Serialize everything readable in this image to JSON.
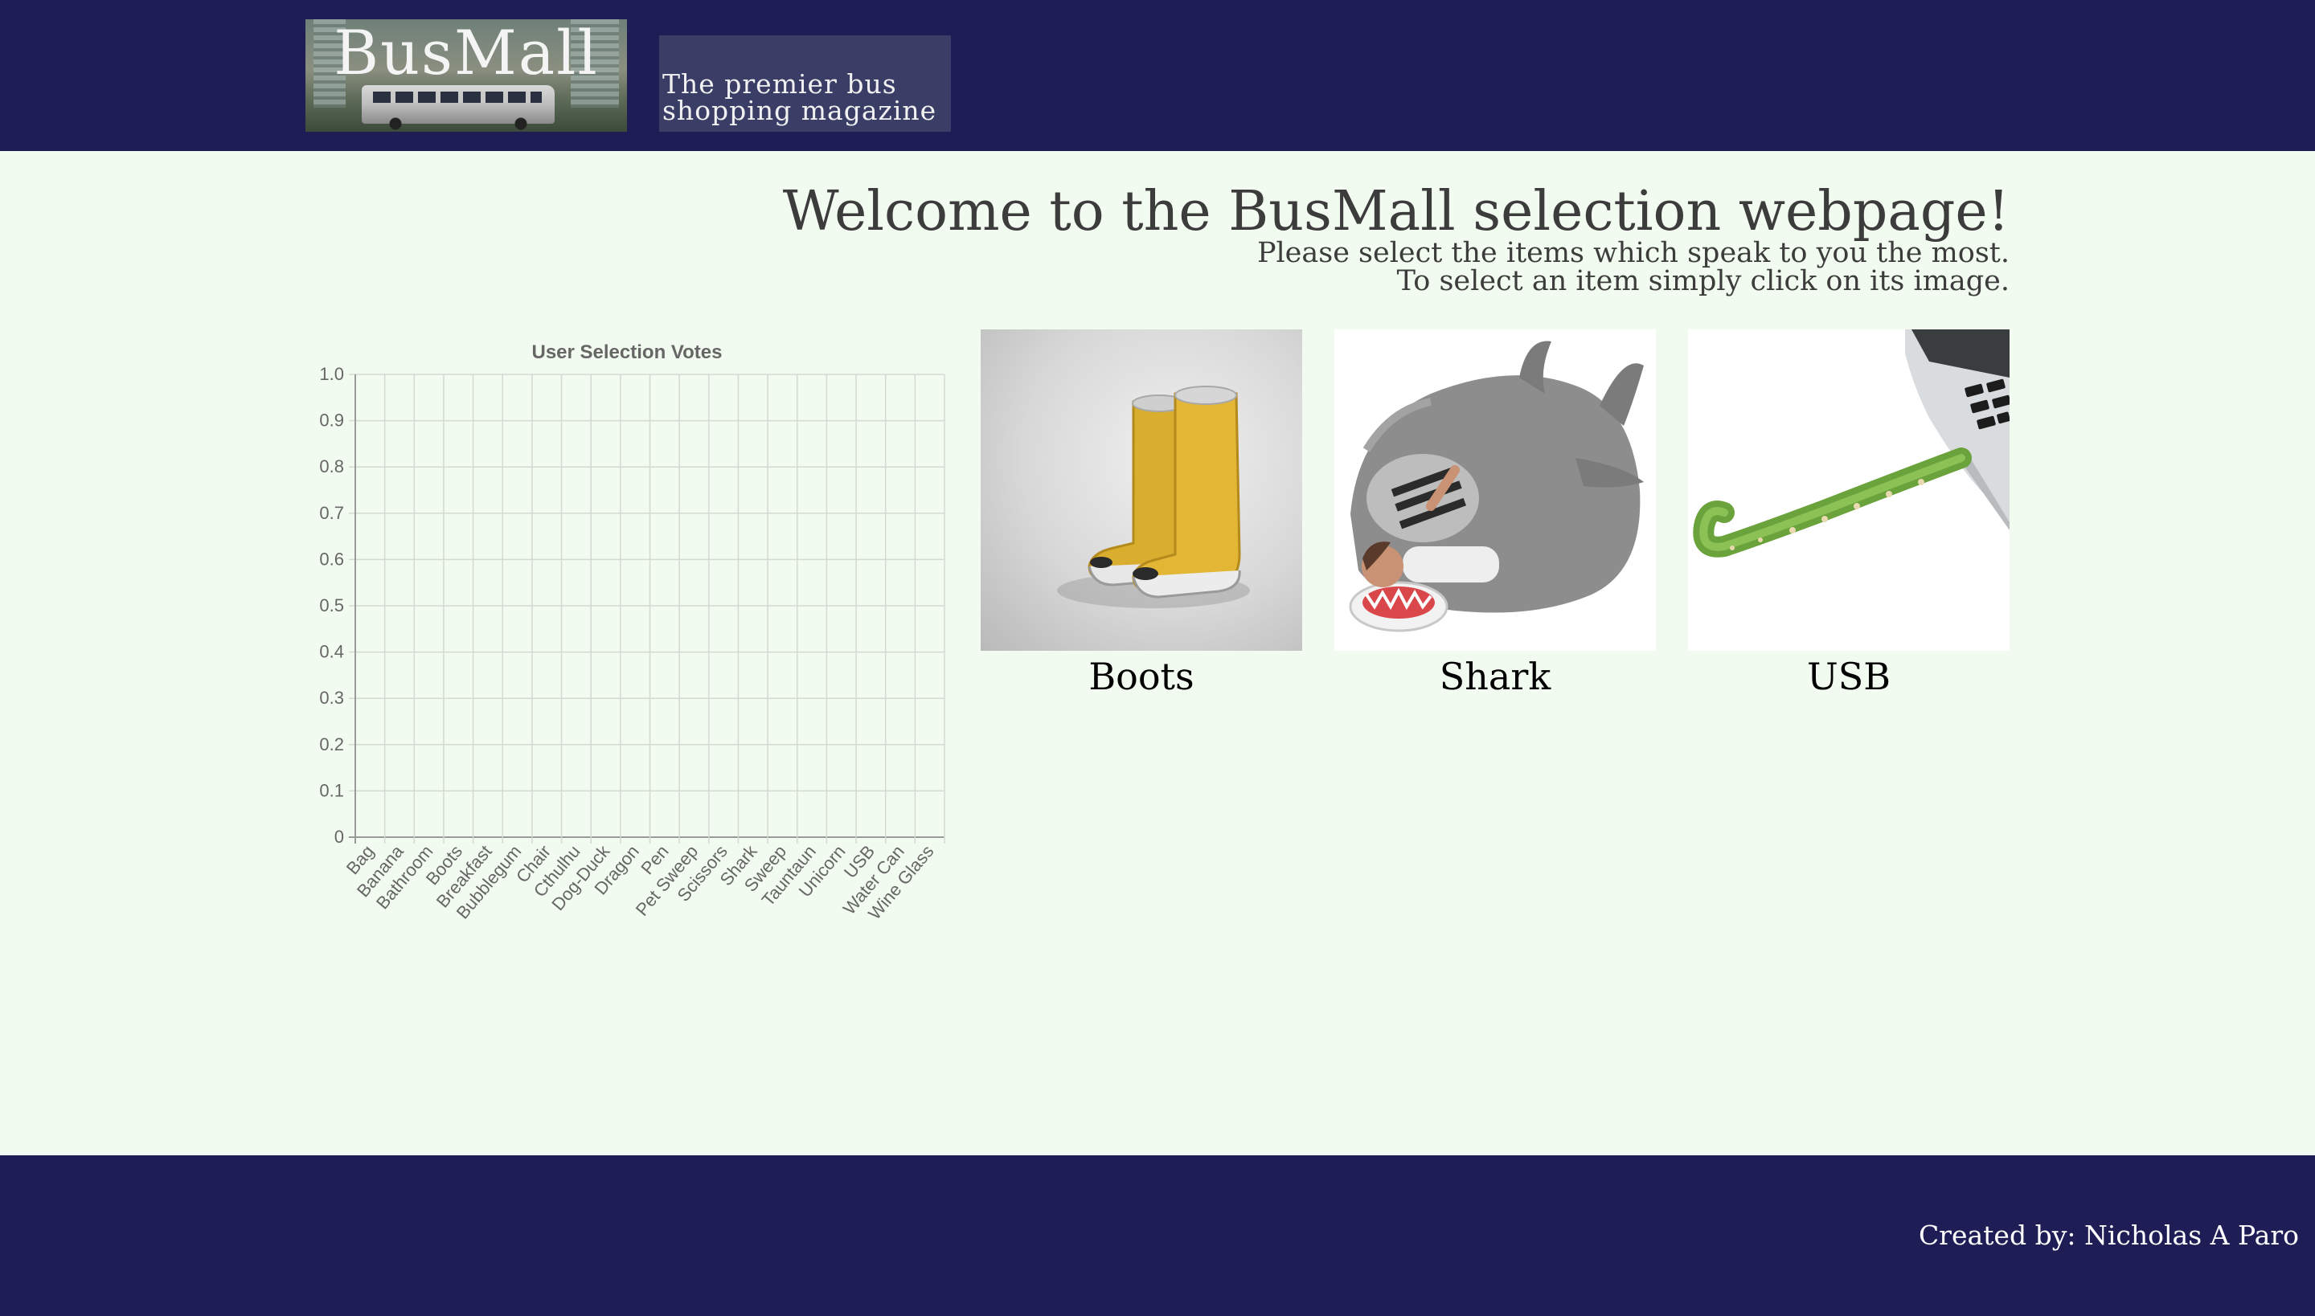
{
  "header": {
    "logo_text": "BusMall",
    "tagline": "The premier bus\nshopping magazine"
  },
  "main": {
    "welcome": "Welcome to the BusMall selection webpage!",
    "instructions_line1": "Please select the items which speak to you the most.",
    "instructions_line2": "To select an item simply click on its image."
  },
  "products": [
    {
      "name": "Boots",
      "icon": "boots-image"
    },
    {
      "name": "Shark",
      "icon": "shark-sleeping-bag-image"
    },
    {
      "name": "USB",
      "icon": "tentacle-usb-image"
    }
  ],
  "chart_data": {
    "type": "bar",
    "title": "User Selection Votes",
    "xlabel": "",
    "ylabel": "",
    "categories": [
      "Bag",
      "Banana",
      "Bathroom",
      "Boots",
      "Breakfast",
      "Bubblegum",
      "Chair",
      "Cthulhu",
      "Dog-Duck",
      "Dragon",
      "Pen",
      "Pet Sweep",
      "Scissors",
      "Shark",
      "Sweep",
      "Tauntaun",
      "Unicorn",
      "USB",
      "Water Can",
      "Wine Glass"
    ],
    "values": [
      0,
      0,
      0,
      0,
      0,
      0,
      0,
      0,
      0,
      0,
      0,
      0,
      0,
      0,
      0,
      0,
      0,
      0,
      0,
      0
    ],
    "ylim": [
      0,
      1.0
    ],
    "yticks": [
      "0",
      "0.1",
      "0.2",
      "0.3",
      "0.4",
      "0.5",
      "0.6",
      "0.7",
      "0.8",
      "0.9",
      "1.0"
    ],
    "grid": true,
    "legend": "none"
  },
  "footer": {
    "credit": "Created by: Nicholas A Paro"
  },
  "colors": {
    "header_bg": "#1f1d56",
    "page_bg": "#f2fbef",
    "grid": "#d4d9d2",
    "axis_text": "#666666"
  }
}
